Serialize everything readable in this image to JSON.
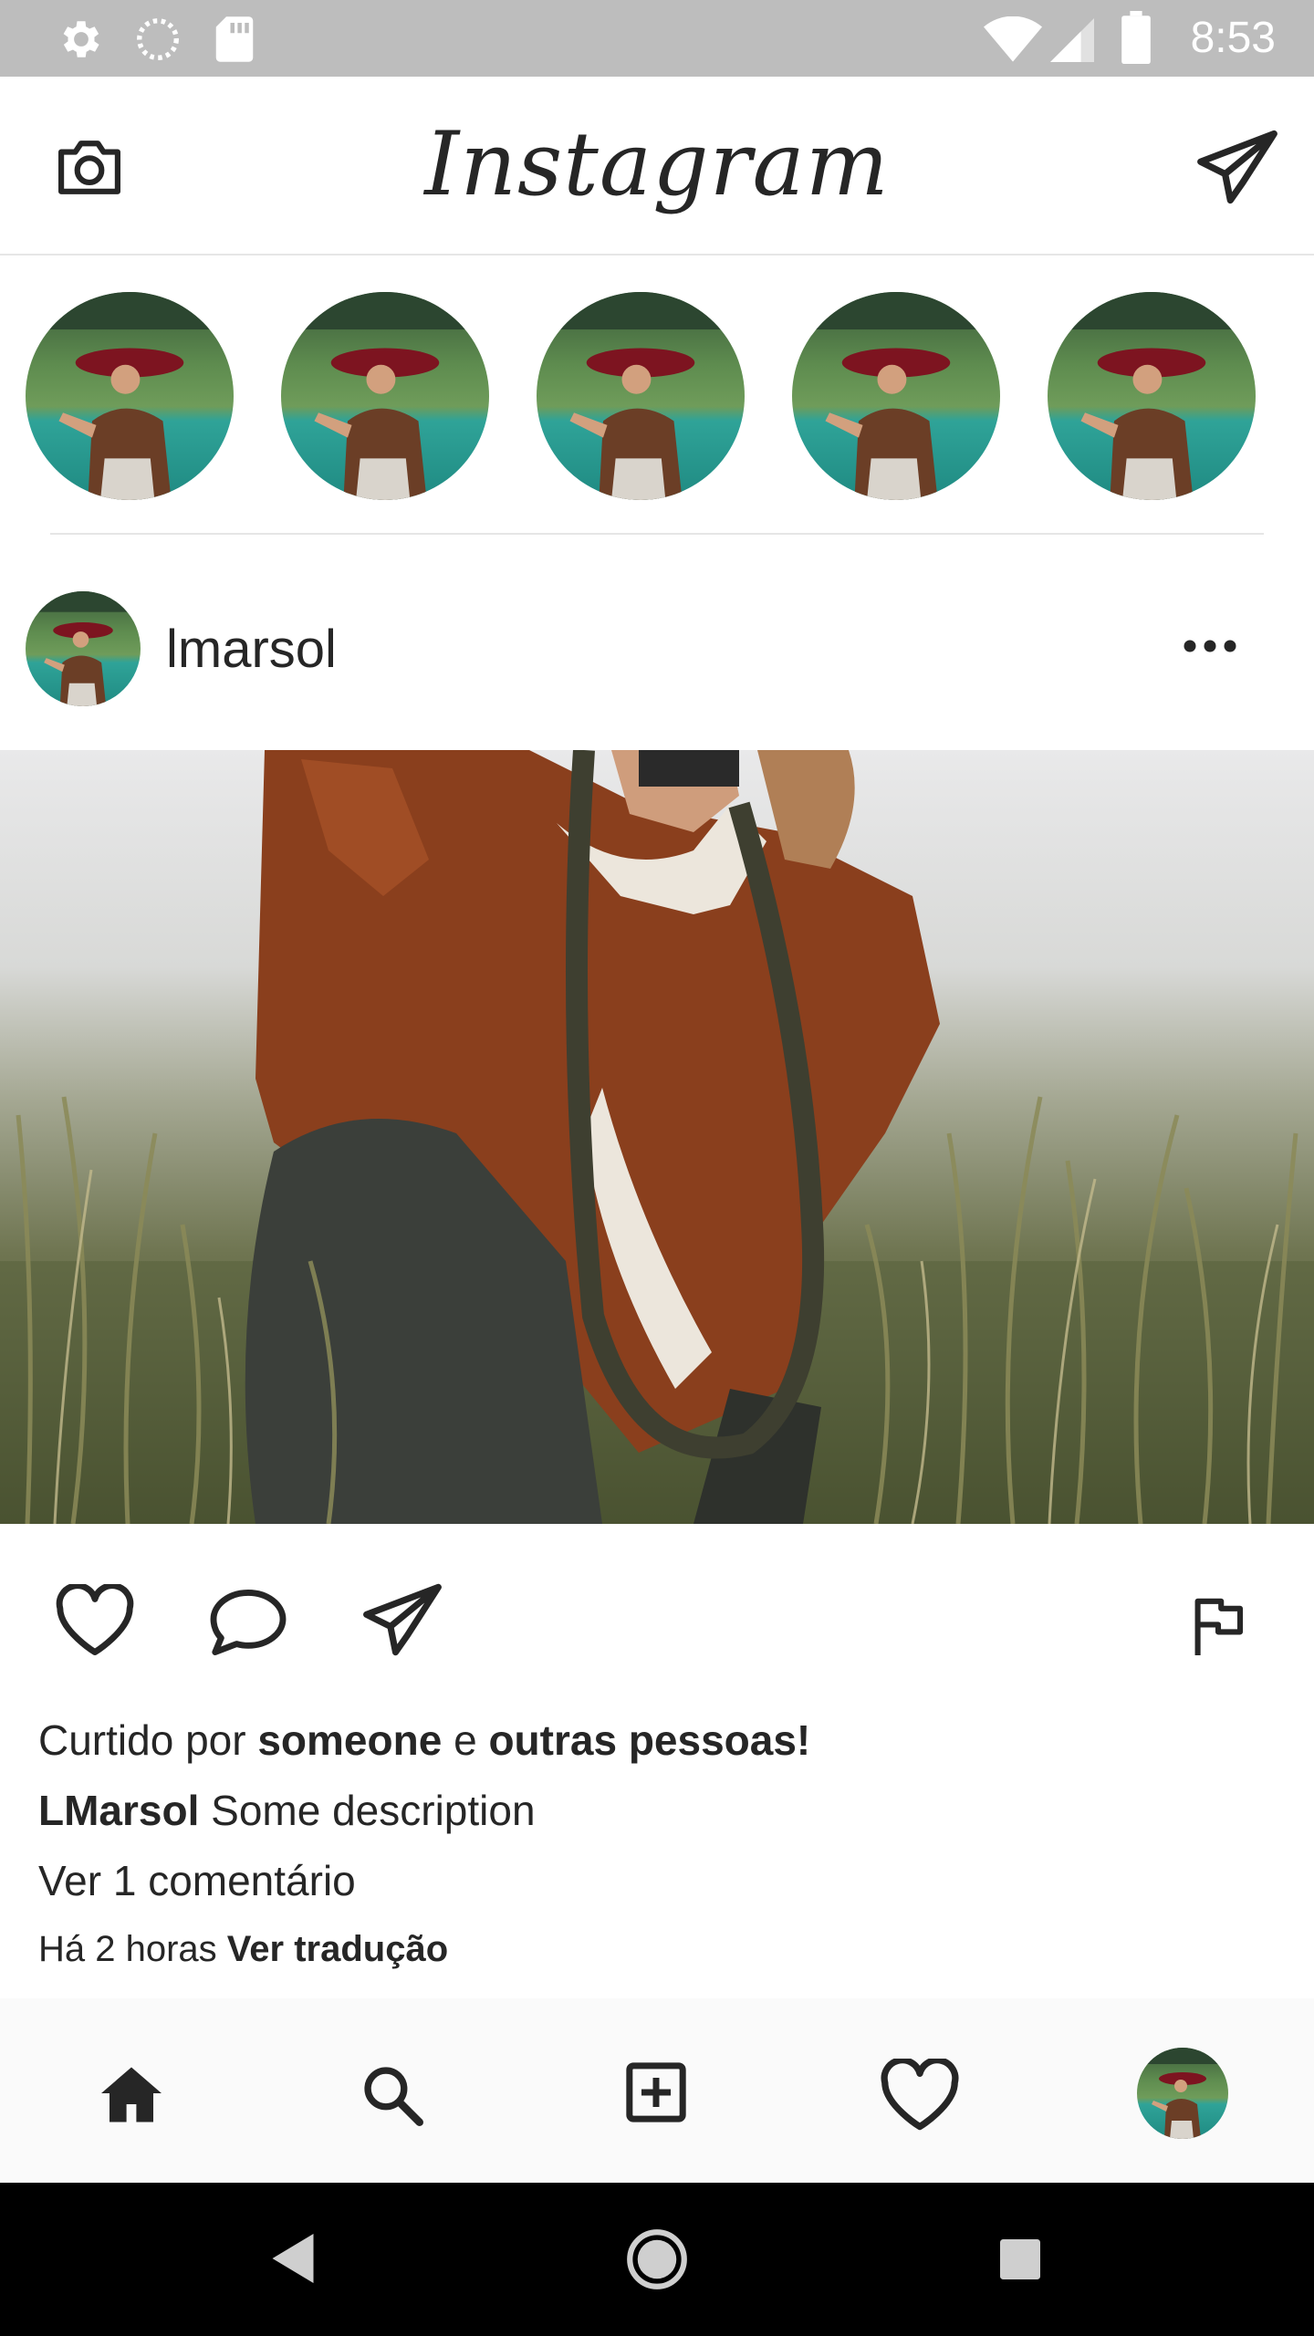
{
  "status_bar": {
    "time": "8:53",
    "icons": [
      "settings-icon",
      "sync-icon",
      "sd-card-icon",
      "wifi-icon",
      "signal-icon",
      "battery-icon"
    ]
  },
  "header": {
    "logo_text": "Instagram",
    "left_icon": "camera-icon",
    "right_icon": "direct-message-icon"
  },
  "stories": [
    {
      "avatar": "story-avatar"
    },
    {
      "avatar": "story-avatar"
    },
    {
      "avatar": "story-avatar"
    },
    {
      "avatar": "story-avatar"
    },
    {
      "avatar": "story-avatar"
    }
  ],
  "post": {
    "username": "lmarsol",
    "liked_by_prefix": "Curtido por",
    "liked_by_user": "someone",
    "liked_by_and": "e",
    "liked_by_others": "outras pessoas!",
    "caption_user": "LMarsol",
    "caption_text": "Some description",
    "comments_link": "Ver 1 comentário",
    "time_ago": "Há 2 horas",
    "translate_link": "Ver tradução"
  },
  "bottom_nav": [
    "home-icon",
    "search-icon",
    "add-post-icon",
    "activity-heart-icon",
    "profile-avatar"
  ],
  "colors": {
    "status_bar": "#bdbdbd",
    "text": "#262626",
    "nav_bg": "#fafafa",
    "system_nav": "#000000"
  }
}
